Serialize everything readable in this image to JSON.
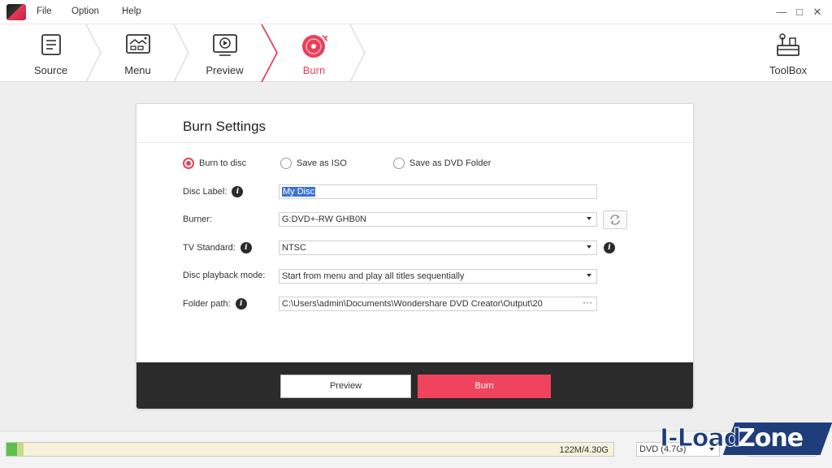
{
  "menu": {
    "file": "File",
    "option": "Option",
    "help": "Help"
  },
  "window": {
    "minimize": "—",
    "maximize": "□",
    "close": "✕"
  },
  "steps": [
    {
      "label": "Source",
      "icon": "source-icon"
    },
    {
      "label": "Menu",
      "icon": "menu-template-icon"
    },
    {
      "label": "Preview",
      "icon": "preview-icon"
    },
    {
      "label": "Burn",
      "icon": "burn-disc-icon",
      "active": true
    }
  ],
  "toolbox": {
    "label": "ToolBox",
    "icon": "toolbox-icon"
  },
  "burn_settings": {
    "title": "Burn Settings",
    "options": {
      "burn_to_disc": "Burn to disc",
      "save_as_iso": "Save as ISO",
      "save_as_dvd_folder": "Save as DVD Folder",
      "selected": "burn_to_disc"
    },
    "disc_label": {
      "label": "Disc Label:",
      "value": "My Disc"
    },
    "burner": {
      "label": "Burner:",
      "value": "G:DVD+-RW GHB0N"
    },
    "tv_standard": {
      "label": "TV Standard:",
      "value": "NTSC"
    },
    "playback_mode": {
      "label": "Disc playback mode:",
      "value": "Start from menu and play all titles sequentially"
    },
    "folder_path": {
      "label": "Folder path:",
      "value": "C:\\Users\\admin\\Documents\\Wondershare DVD Creator\\Output\\20",
      "browse": "···"
    },
    "info_glyph": "i",
    "buttons": {
      "preview": "Preview",
      "burn": "Burn"
    }
  },
  "status": {
    "usage_text": "122M/4.30G",
    "usage_fraction": 0.028,
    "disc_type": "DVD (4.7G)"
  },
  "watermark": {
    "part1": "I-Load",
    "part2": "Zone"
  },
  "colors": {
    "accent": "#e8405b",
    "burn_button": "#f0445e",
    "footer": "#2b2b2b",
    "usage_green": "#5fbf4e"
  }
}
